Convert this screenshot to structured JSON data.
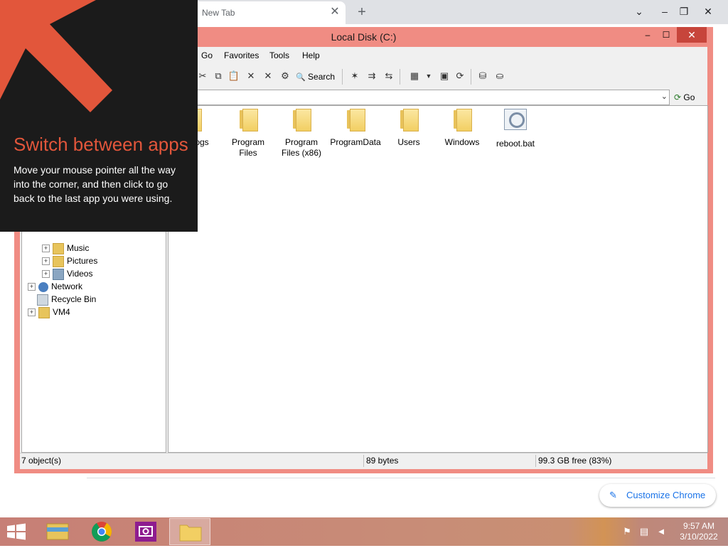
{
  "chrome": {
    "tab_title": "New Tab",
    "tab_close": "✕",
    "new_tab": "+",
    "customize_label": "Customize Chrome",
    "pencil": "✎",
    "controls": {
      "dropdown": "⌄",
      "minimize": "–",
      "restore": "❐",
      "close": "✕"
    }
  },
  "explorer": {
    "title": "Local Disk (C:)",
    "window_buttons": {
      "minimize": "–",
      "maximize": "☐",
      "close": "✕"
    },
    "menu": [
      "Go",
      "Favorites",
      "Tools",
      "Help"
    ],
    "toolbar": {
      "search_label": "Search",
      "search_icon": "🔍"
    },
    "address": {
      "value": "",
      "dropdown": "⌄",
      "go_label": "Go",
      "go_icon": "⟳"
    },
    "tree": [
      {
        "label": "Music",
        "expander": "+",
        "icon": "music-folder-icon"
      },
      {
        "label": "Pictures",
        "expander": "+",
        "icon": "pictures-folder-icon"
      },
      {
        "label": "Videos",
        "expander": "+",
        "icon": "videos-folder-icon"
      },
      {
        "label": "Network",
        "expander": "+",
        "icon": "network-icon"
      },
      {
        "label": "Recycle Bin",
        "expander": "",
        "icon": "recycle-bin-icon"
      },
      {
        "label": "VM4",
        "expander": "+",
        "icon": "user-folder-icon"
      }
    ],
    "files": [
      {
        "name": "ogs",
        "type": "folder"
      },
      {
        "name": "Program Files",
        "type": "folder"
      },
      {
        "name": "Program Files (x86)",
        "type": "folder"
      },
      {
        "name": "ProgramData",
        "type": "folder"
      },
      {
        "name": "Users",
        "type": "folder"
      },
      {
        "name": "Windows",
        "type": "folder"
      },
      {
        "name": "reboot.bat",
        "type": "batch-file"
      }
    ],
    "status": {
      "objects": "7 object(s)",
      "size": "89 bytes",
      "free": "99.3 GB free (83%)"
    }
  },
  "overlay": {
    "title": "Switch between apps",
    "body": "Move your mouse pointer all the way into the corner, and then click to go back to the last app you were using."
  },
  "taskbar": {
    "apps": [
      "file-explorer-icon",
      "chrome-icon",
      "camera-app-icon",
      "folder-icon"
    ],
    "clock_time": "9:57 AM",
    "clock_date": "3/10/2022",
    "tray": [
      "action-center-flag-icon",
      "network-icon",
      "volume-muted-icon"
    ]
  },
  "colors": {
    "window_border": "#f08c83",
    "accent_orange": "#e2563b",
    "close_red": "#c7453b",
    "overlay_bg": "#1b1b1b",
    "chrome_link": "#1a73e8"
  }
}
